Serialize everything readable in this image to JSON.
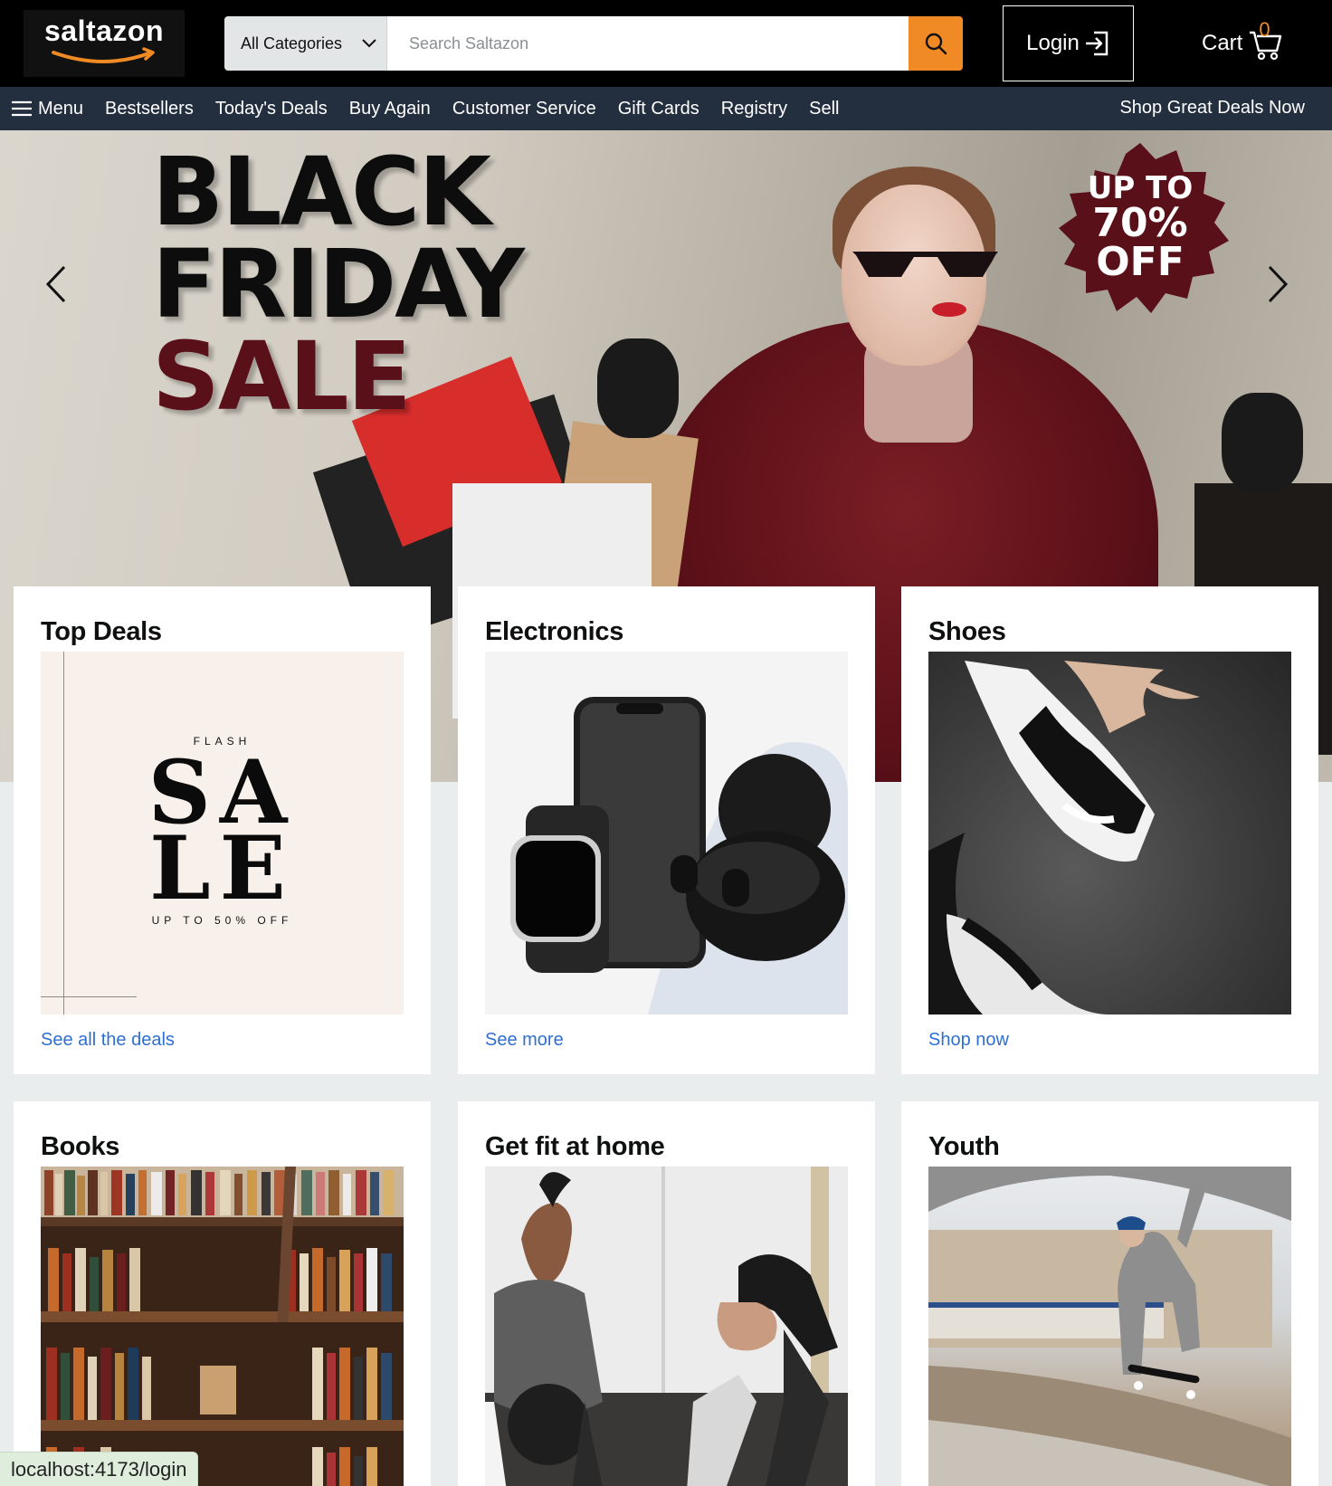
{
  "header": {
    "logo_text": "saltazon",
    "search": {
      "category": "All Categories",
      "placeholder": "Search Saltazon",
      "value": ""
    },
    "login_label": "Login",
    "cart_label": "Cart",
    "cart_count": "0",
    "accent_color": "#f08a24"
  },
  "nav": {
    "menu_label": "Menu",
    "items": [
      "Bestsellers",
      "Today's Deals",
      "Buy Again",
      "Customer Service",
      "Gift Cards",
      "Registry",
      "Sell"
    ],
    "right_link": "Shop Great Deals Now"
  },
  "hero": {
    "line1": "BLACK",
    "line2": "FRIDAY",
    "line3": "SALE",
    "badge_l1": "UP TO",
    "badge_l2": "70%",
    "badge_l3": "OFF"
  },
  "cards": [
    {
      "title": "Top Deals",
      "link": "See all the deals",
      "image": {
        "flash": "FLASH",
        "sa": "SA",
        "le": "LE",
        "upto": "UP TO 50% OFF"
      }
    },
    {
      "title": "Electronics",
      "link": "See more"
    },
    {
      "title": "Shoes",
      "link": "Shop now"
    },
    {
      "title": "Books"
    },
    {
      "title": "Get fit at home"
    },
    {
      "title": "Youth"
    }
  ],
  "status_bar": "localhost:4173/login"
}
